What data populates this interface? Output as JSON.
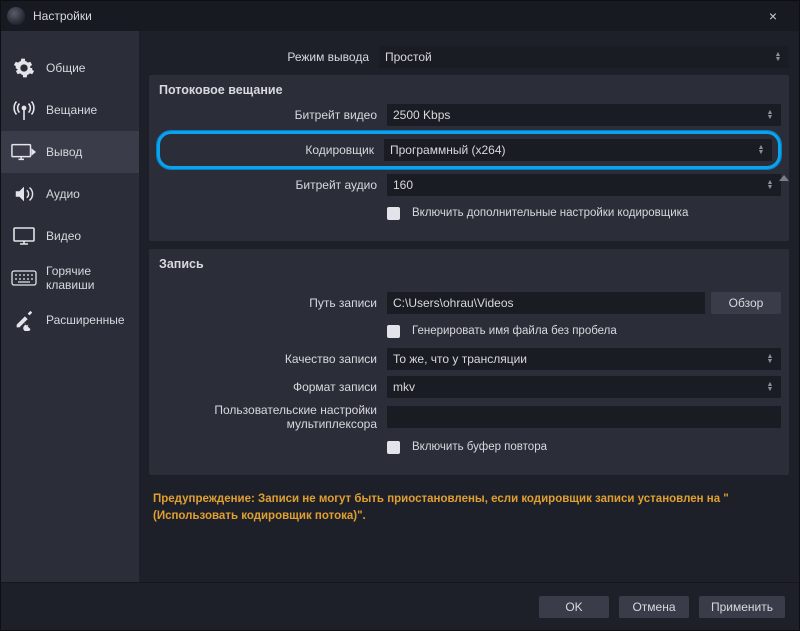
{
  "title": "Настройки",
  "sidebar": {
    "items": [
      {
        "label": "Общие"
      },
      {
        "label": "Вещание"
      },
      {
        "label": "Вывод"
      },
      {
        "label": "Аудио"
      },
      {
        "label": "Видео"
      },
      {
        "label": "Горячие клавиши"
      },
      {
        "label": "Расширенные"
      }
    ]
  },
  "output_mode": {
    "label": "Режим вывода",
    "value": "Простой"
  },
  "streaming": {
    "title": "Потоковое вещание",
    "video_bitrate": {
      "label": "Битрейт видео",
      "value": "2500 Kbps"
    },
    "encoder": {
      "label": "Кодировщик",
      "value": "Программный (x264)"
    },
    "audio_bitrate": {
      "label": "Битрейт аудио",
      "value": "160"
    },
    "advanced_check": "Включить дополнительные настройки кодировщика"
  },
  "recording": {
    "title": "Запись",
    "path": {
      "label": "Путь записи",
      "value": "C:\\Users\\ohrau\\Videos",
      "browse": "Обзор"
    },
    "no_space_check": "Генерировать имя файла без пробела",
    "quality": {
      "label": "Качество записи",
      "value": "То же, что у трансляции"
    },
    "format": {
      "label": "Формат записи",
      "value": "mkv"
    },
    "muxer": {
      "label": "Пользовательские настройки мультиплексора",
      "value": ""
    },
    "replay_check": "Включить буфер повтора"
  },
  "warning": "Предупреждение: Записи не могут быть приостановлены, если кодировщик записи установлен на \"(Использовать кодировщик потока)\".",
  "footer": {
    "ok": "OK",
    "cancel": "Отмена",
    "apply": "Применить"
  }
}
